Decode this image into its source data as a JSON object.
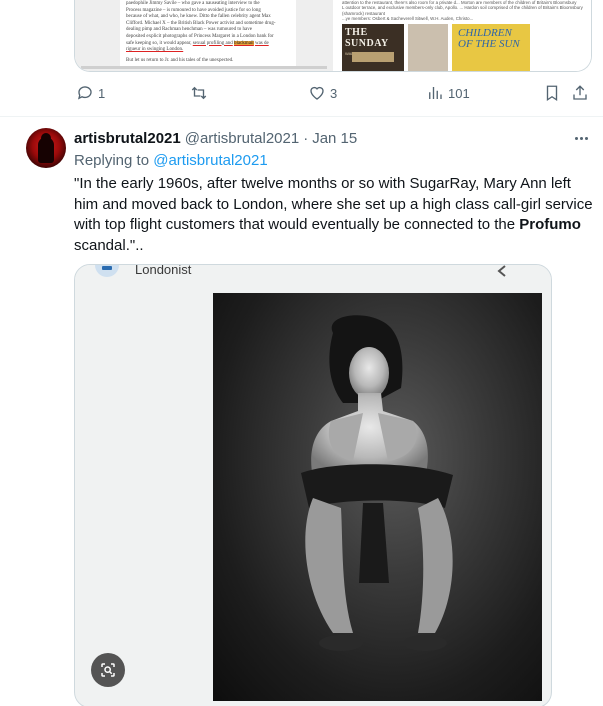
{
  "previous_tweet": {
    "media_left": {
      "lines": [
        "paedophile Jimmy Savile – who gave a nauseating interview to the",
        "Process magazine – is rumoured to have avoided justice for so long",
        "because of what, and who, he knew. Ditto the fallen celebrity agent Max",
        "Clifford. Michael X – the British Black Power activist and sometime drug-",
        "dealing pimp and Rachman henchman – was rumoured to have",
        "deposited explicit photographs of Princess Margaret in a London bank for",
        "safe keeping so, it would appear,",
        "rigueur in swinging London.",
        "But let us return to Jr. and his tales of the unexpected."
      ],
      "link_words": [
        "interview to the",
        "Process"
      ],
      "underlined_before": "sexual profiling and",
      "highlight_word": "blackmail",
      "underlined_after": "was de"
    },
    "media_right": {
      "text_lines": [
        "attention to the restaurant, there's also room for a private d... Morton are members of the children of Britain's Bloomsbury",
        "L outdoor terrace, and exclusive members-only club, Apollo. ... Hardon soil comprised of the children of Britain's Bloomsbury",
        "(shamrock) restaurant",
        "   ...ye members: Osbert & Sacheverell Sitwell, W.H. Auden, Christo...",
        "   ...erwood, Stephen Spender, Evelyn Waugh & Cecil Beaton"
      ],
      "book1_title": "THE SUNDAY",
      "book1_sub": "WANTED",
      "book3_title": "CHILDREN OF THE SUN"
    },
    "actions": {
      "reply_count": "1",
      "retweet_count": "",
      "like_count": "3",
      "views_count": "101"
    }
  },
  "tweet": {
    "author_name": "artisbrutal2021",
    "author_handle": "@artisbrutal2021",
    "separator": "·",
    "date": "Jan 15",
    "replying_prefix": "Replying to",
    "replying_mention": "@artisbrutal2021",
    "text_before_bold": "\"In the early 1960s, after twelve months or so with SugarRay, Mary Ann left him and moved back to London, where she set up a high class call-girl service with top flight customers that would eventually be connected to the ",
    "text_bold": "Profumo",
    "text_after_bold": " scandal.\".."
  },
  "media_card": {
    "site_name": "Londonist"
  },
  "icons": {
    "reply": "reply-icon",
    "retweet": "retweet-icon",
    "like": "heart-icon",
    "views": "views-icon",
    "bookmark": "bookmark-icon",
    "share": "share-icon",
    "more": "more-icon",
    "alt_text": "image-search-icon"
  },
  "colors": {
    "text": "#0f1419",
    "secondary": "#536471",
    "accent": "#1d9bf0",
    "border": "#cfd9de"
  }
}
